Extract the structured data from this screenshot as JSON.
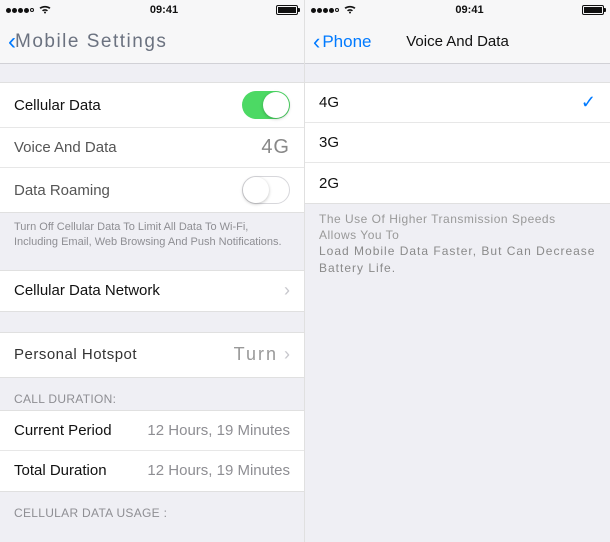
{
  "status": {
    "time": "09:41"
  },
  "left": {
    "nav_back": "Mobile Settings",
    "rows": {
      "cellular_data": "Cellular Data",
      "voice_and_data": {
        "label": "Voice And Data",
        "value": "4G"
      },
      "data_roaming": "Data Roaming"
    },
    "footer1": "Turn Off Cellular Data To Limit All Data To Wi-Fi, Including Email, Web Browsing And Push Notifications.",
    "cellular_network": "Cellular Data Network",
    "hotspot": {
      "label": "Personal Hotspot",
      "value": "Turn"
    },
    "call_duration": {
      "header": "CALL DURATION:",
      "current_label": "Current Period",
      "current_value": "12 Hours, 19 Minutes",
      "total_label": "Total Duration",
      "total_value": "12 Hours, 19 Minutes"
    },
    "usage_header": "CELLULAR DATA USAGE :"
  },
  "right": {
    "nav_back": "Phone",
    "nav_title": "Voice And Data",
    "options": {
      "opt1": "4G",
      "opt2": "3G",
      "opt3": "2G"
    },
    "footer_l1": "The Use Of Higher Transmission Speeds Allows You To",
    "footer_l2": "Load Mobile Data Faster, But Can Decrease Battery Life."
  }
}
